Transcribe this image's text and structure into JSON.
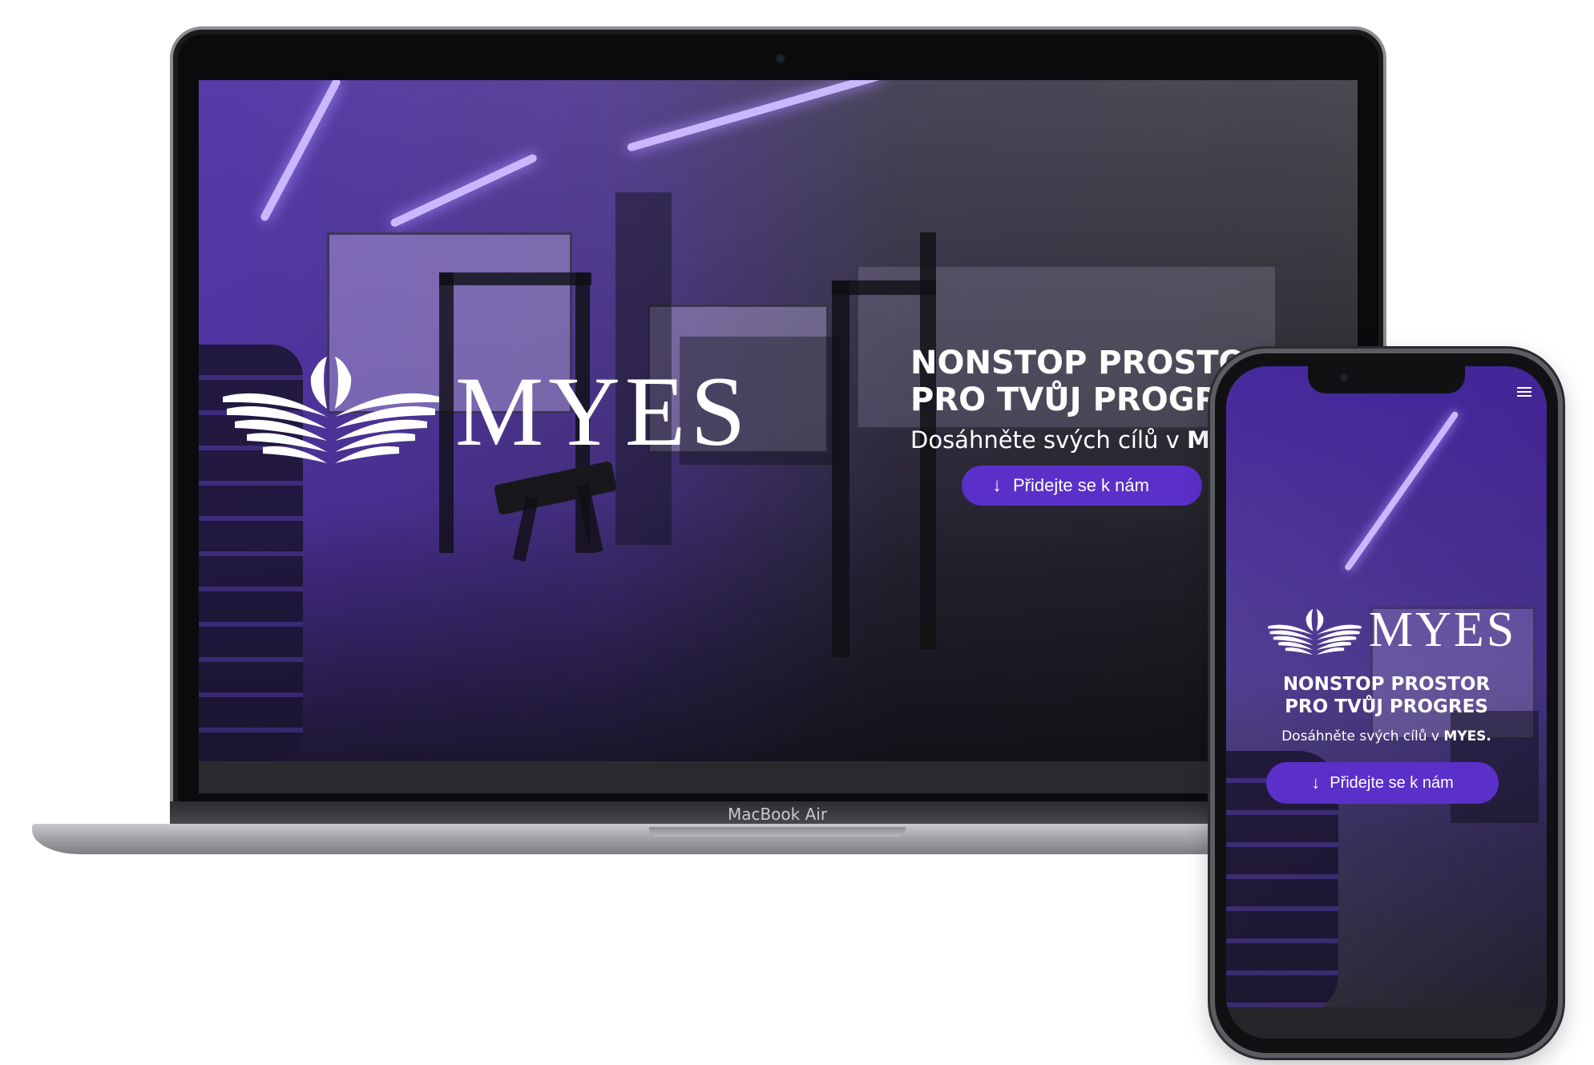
{
  "device_labels": {
    "laptop": "MacBook Air"
  },
  "laptop_site": {
    "brand": "MYES",
    "hero_title_line1": "NONSTOP PROSTOR",
    "hero_title_line2": "PRO TVŮJ PROGRES",
    "hero_sub_text": "Dosáhněte svých cílů v ",
    "hero_sub_brand": "MYES.",
    "cta_label": "Přidejte se k nám"
  },
  "phone_site": {
    "brand": "MYES",
    "hero_title_line1": "NONSTOP PROSTOR",
    "hero_title_line2": "PRO TVŮJ PROGRES",
    "hero_sub_text": "Dosáhněte svých cílů v ",
    "hero_sub_brand": "MYES.",
    "cta_label": "Přidejte se k nám",
    "menu_icon": "hamburger-icon"
  },
  "colors": {
    "accent": "#5a30c8",
    "overlay_purple": "#5632be",
    "light_strip": "#c9b8ff"
  }
}
